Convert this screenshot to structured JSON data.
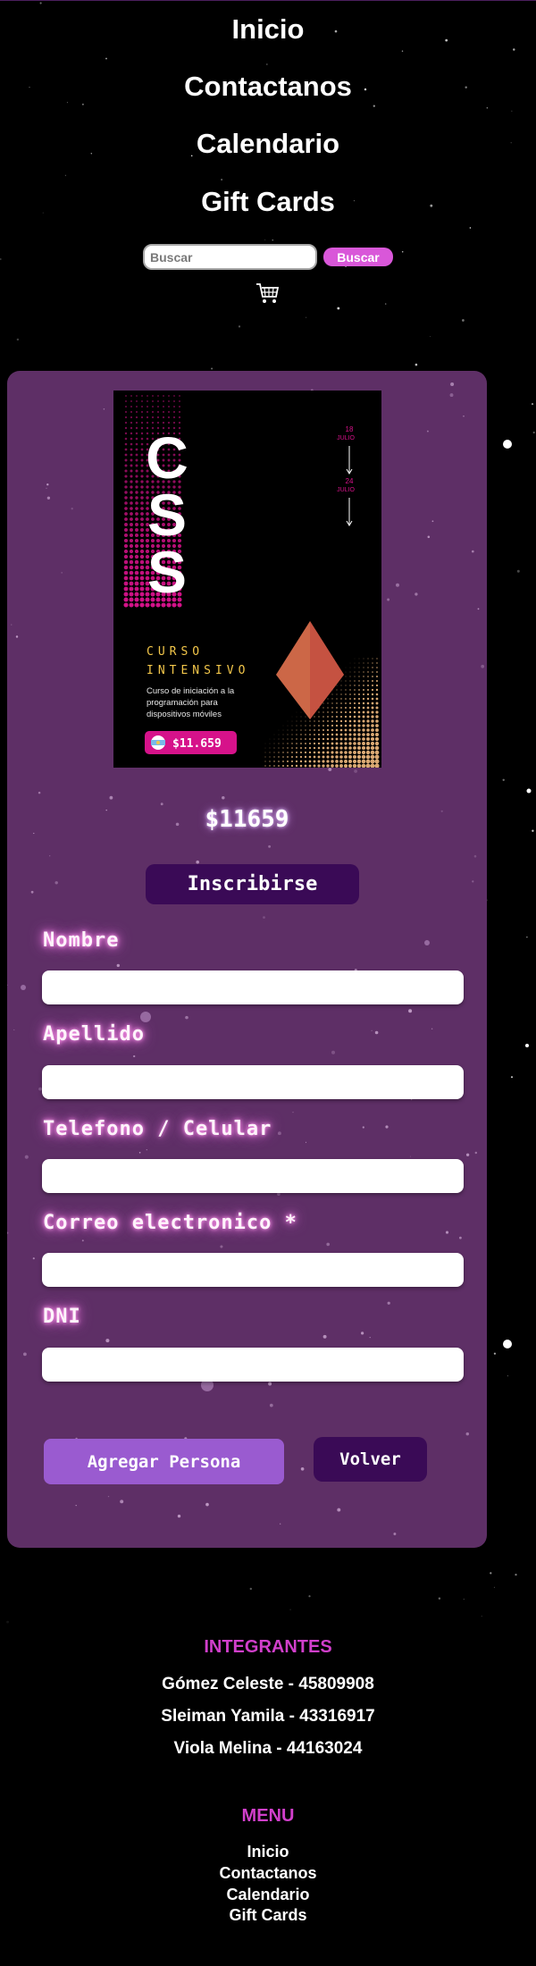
{
  "nav": {
    "items": [
      {
        "label": "Inicio"
      },
      {
        "label": "Contactanos"
      },
      {
        "label": "Calendario"
      },
      {
        "label": "Gift Cards"
      }
    ]
  },
  "search": {
    "placeholder": "Buscar",
    "button_label": "Buscar"
  },
  "poster": {
    "title_letters": [
      "C",
      "S",
      "S"
    ],
    "dates": [
      {
        "day": "18",
        "month": "JULIO"
      },
      {
        "day": "24",
        "month": "JULIO"
      }
    ],
    "course_line1": "CURSO",
    "course_line2": "INTENSIVO",
    "description_lines": [
      "Curso de iniciación a la",
      "programación para",
      "dispositivos móviles"
    ],
    "badge_price": "$11.659",
    "accent_color": "#d6128a",
    "gold_color": "#f2c64a"
  },
  "course": {
    "price": "$11659",
    "enroll_label": "Inscribirse"
  },
  "form": {
    "fields": [
      {
        "label": "Nombre"
      },
      {
        "label": "Apellido"
      },
      {
        "label": "Telefono / Celular"
      },
      {
        "label": "Correo electronico *"
      },
      {
        "label": "DNI"
      }
    ],
    "add_label": "Agregar Persona",
    "back_label": "Volver"
  },
  "footer": {
    "members_title": "INTEGRANTES",
    "members": [
      "Gómez Celeste - 45809908",
      "Sleiman Yamila - 43316917",
      "Viola Melina - 44163024"
    ],
    "menu_title": "MENU",
    "menu": [
      "Inicio",
      "Contactanos",
      "Calendario",
      "Gift Cards"
    ]
  },
  "colors": {
    "card": "#5e2f66",
    "search_button": "#d957d9",
    "dark_button": "#3a0a56",
    "add_button": "#9a5bd0",
    "footer_title": "#d13fcb"
  },
  "icons": {
    "cart": "shopping-cart-icon"
  }
}
